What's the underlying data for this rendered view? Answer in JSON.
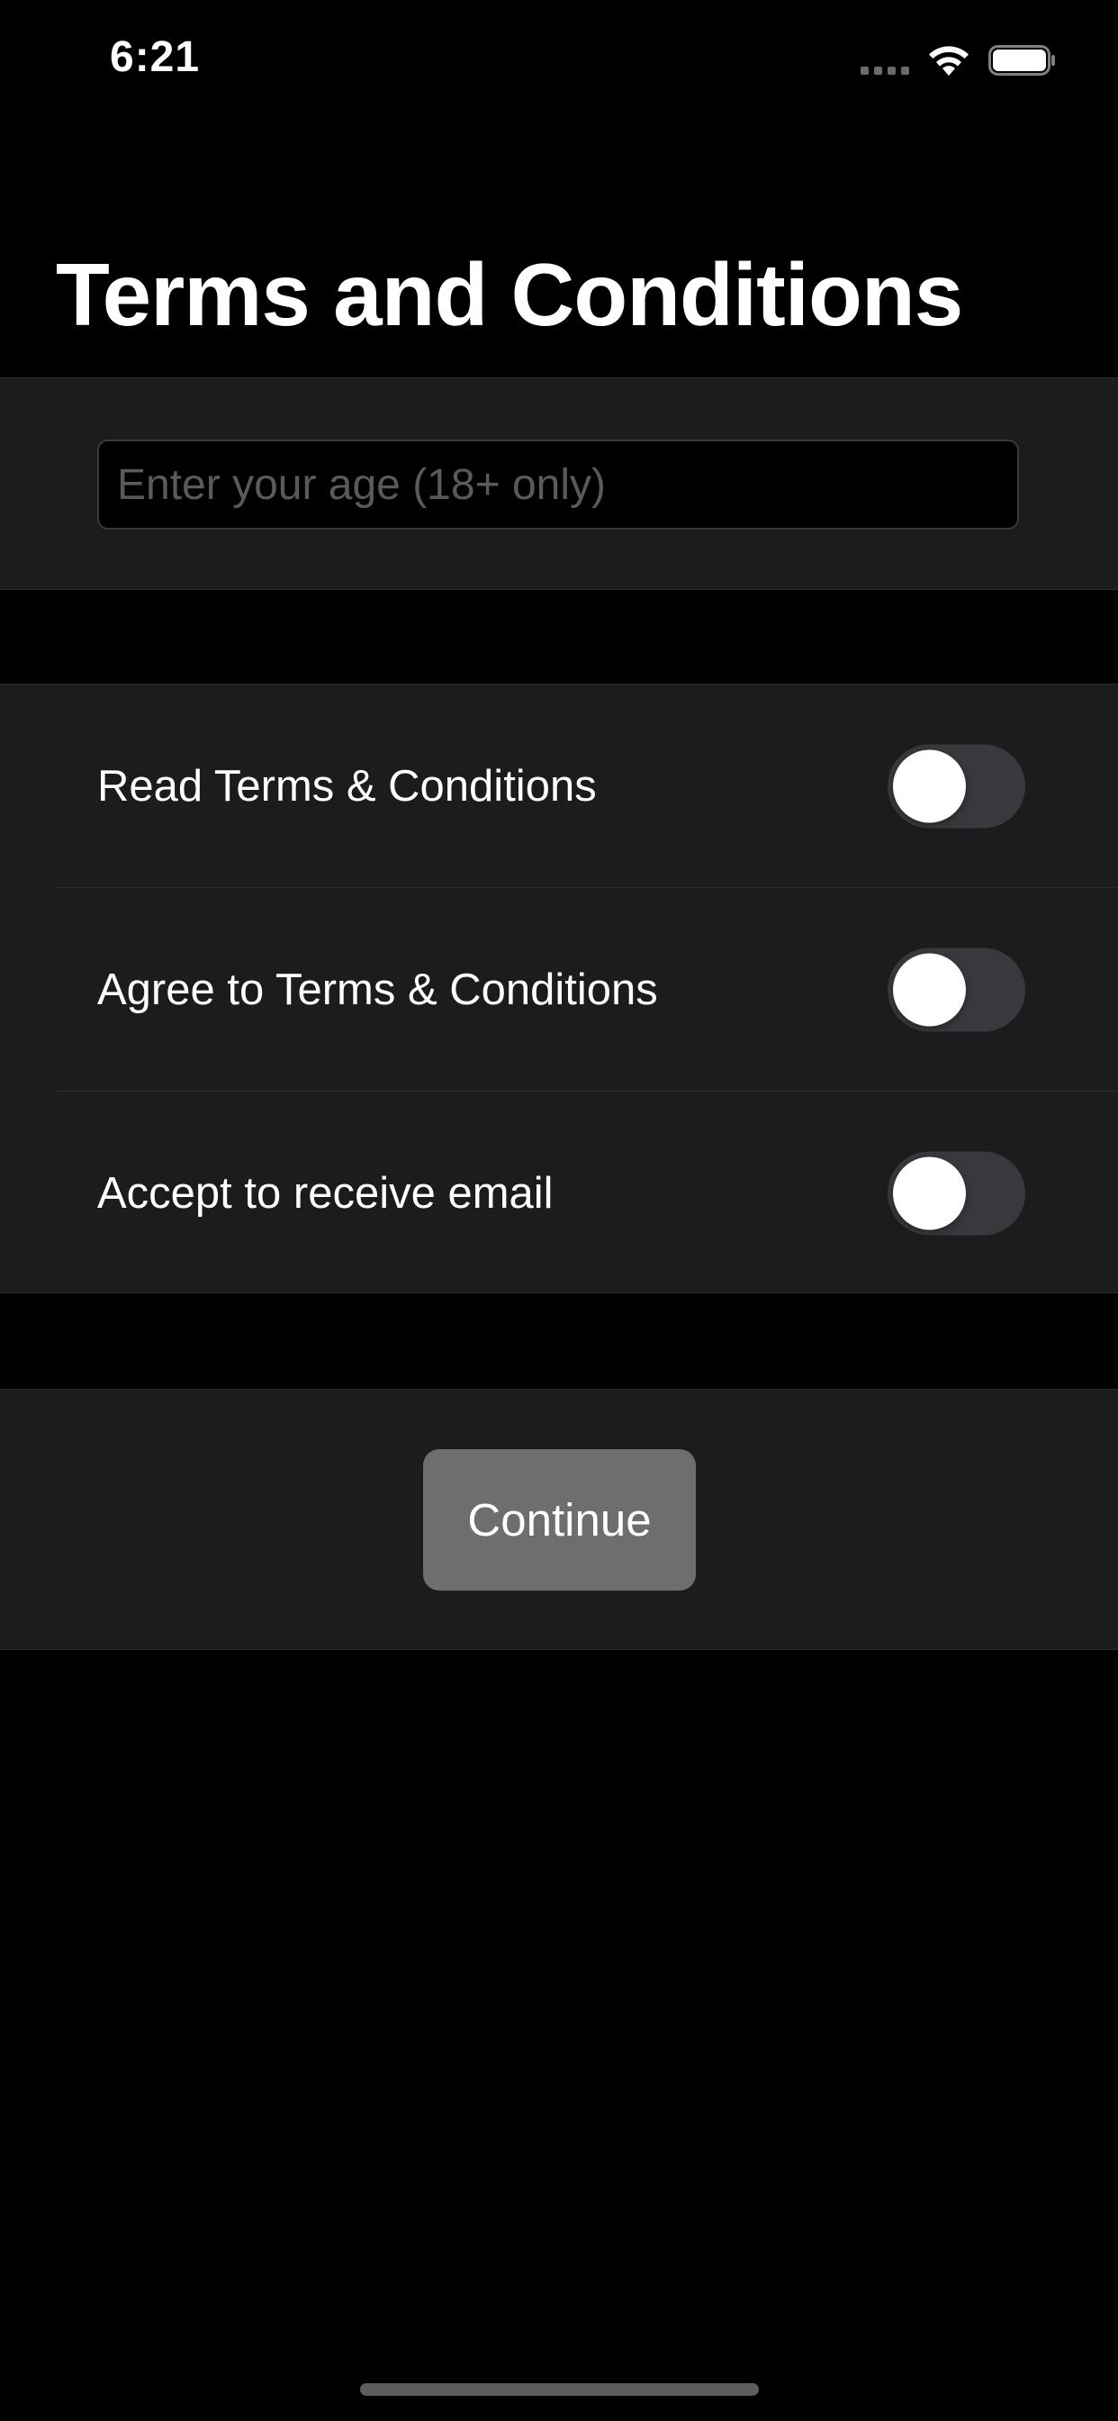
{
  "status_bar": {
    "time": "6:21",
    "icons": [
      "signal-icon",
      "wifi-icon",
      "battery-icon"
    ]
  },
  "header": {
    "title": "Terms and Conditions"
  },
  "age_section": {
    "input_value": "",
    "input_placeholder": "Enter your age (18+ only)"
  },
  "toggles": [
    {
      "label": "Read Terms & Conditions",
      "on": false
    },
    {
      "label": "Agree to Terms & Conditions",
      "on": false
    },
    {
      "label": "Accept to receive email",
      "on": false
    }
  ],
  "actions": {
    "continue_label": "Continue"
  },
  "colors": {
    "background": "#000000",
    "section": "#1c1c1e",
    "toggle_off_track": "#39393d",
    "button_disabled": "#6e6e6e",
    "text": "#ffffff",
    "placeholder": "#5a5a5e"
  }
}
